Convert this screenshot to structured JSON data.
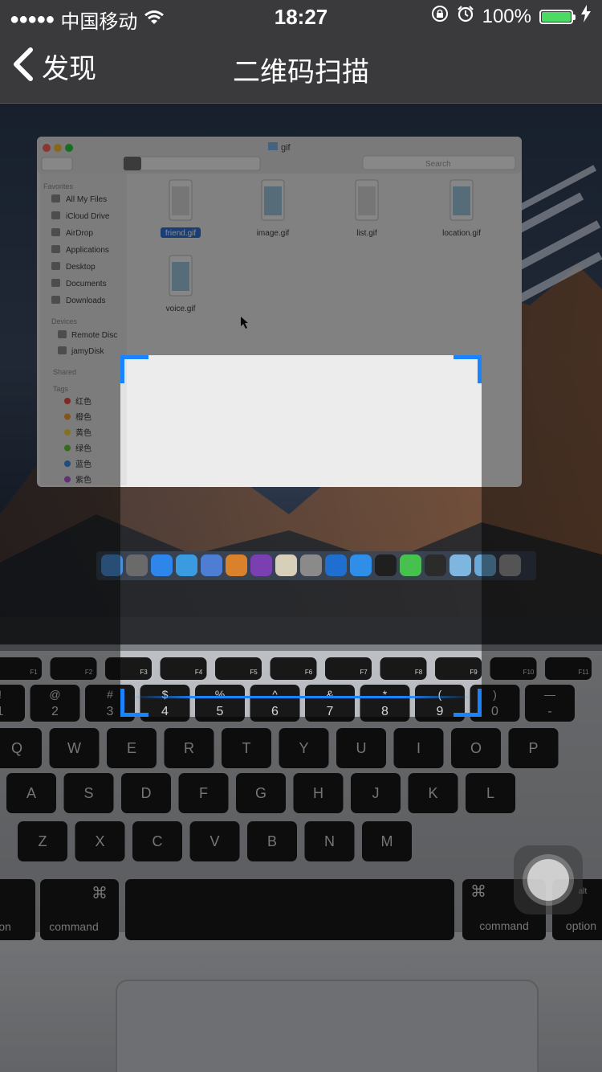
{
  "status_bar": {
    "carrier": "中国移动",
    "time": "18:27",
    "battery_percent": "100%",
    "battery_level": 1.0,
    "signal_icon": "signal-dots-icon",
    "wifi_icon": "wifi-icon",
    "orientation_lock_icon": "orientation-lock-icon",
    "alarm_icon": "alarm-icon",
    "charging_icon": "charging-bolt-icon"
  },
  "nav": {
    "back_label": "发现",
    "back_icon": "chevron-left-icon",
    "title": "二维码扫描"
  },
  "scanner": {
    "frame_color": "#1a84ff"
  },
  "camera_preview": {
    "finder_window_title": "gif",
    "finder_search_placeholder": "Search",
    "favorites_header": "Favorites",
    "favorites": [
      "All My Files",
      "iCloud Drive",
      "AirDrop",
      "Applications",
      "Desktop",
      "Documents",
      "Downloads"
    ],
    "devices_header": "Devices",
    "devices": [
      "Remote Disc",
      "jamyDisk"
    ],
    "shared_header": "Shared",
    "tags_header": "Tags",
    "tags": [
      {
        "label": "红色",
        "color": "#e64a3c"
      },
      {
        "label": "橙色",
        "color": "#f09a2e"
      },
      {
        "label": "黄色",
        "color": "#f2d03b"
      },
      {
        "label": "绿色",
        "color": "#5fc33b"
      },
      {
        "label": "蓝色",
        "color": "#3b8bea"
      },
      {
        "label": "紫色",
        "color": "#b257d6"
      }
    ],
    "files": [
      "friend.gif",
      "image.gif",
      "list.gif",
      "location.gif",
      "voice.gif"
    ],
    "keyboard_rows": [
      [
        "Q",
        "W",
        "E",
        "R",
        "T",
        "Y",
        "U",
        "I",
        "O",
        "P"
      ],
      [
        "A",
        "S",
        "D",
        "F",
        "G",
        "H",
        "J",
        "K",
        "L"
      ],
      [
        "Z",
        "X",
        "C",
        "V",
        "B",
        "N",
        "M"
      ]
    ],
    "number_row": [
      {
        "top": "!",
        "bottom": "1"
      },
      {
        "top": "@",
        "bottom": "2"
      },
      {
        "top": "#",
        "bottom": "3"
      },
      {
        "top": "$",
        "bottom": "4"
      },
      {
        "top": "%",
        "bottom": "5"
      },
      {
        "top": "^",
        "bottom": "6"
      },
      {
        "top": "&",
        "bottom": "7"
      },
      {
        "top": "*",
        "bottom": "8"
      },
      {
        "top": "(",
        "bottom": "9"
      },
      {
        "top": ")",
        "bottom": "0"
      },
      {
        "top": "—",
        "bottom": "-"
      }
    ],
    "fn_keys": [
      "F1",
      "F2",
      "F3",
      "F4",
      "F5",
      "F6",
      "F7",
      "F8",
      "F9",
      "F10",
      "F11"
    ],
    "command_left": "command",
    "command_right": "command",
    "option_key": "option",
    "alt_key": "alt",
    "on_key": "on"
  }
}
